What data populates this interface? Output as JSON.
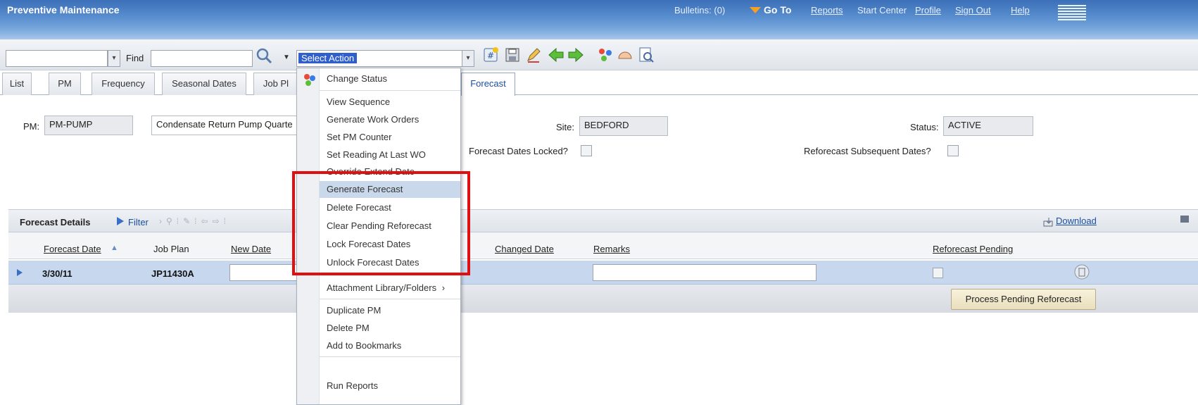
{
  "header": {
    "app_title": "Preventive Maintenance",
    "bulletins": "Bulletins: (0)",
    "go_to": "Go To",
    "links": [
      "Reports",
      "Start Center",
      "Profile",
      "Sign Out",
      "Help"
    ]
  },
  "toolbar": {
    "find_label": "Find",
    "select_action": "Select Action"
  },
  "tabs": [
    "List",
    "PM",
    "Frequency",
    "Seasonal Dates",
    "Job Pl",
    "Forecast"
  ],
  "fields": {
    "pm_label": "PM:",
    "pm_value": "PM-PUMP",
    "description": "Condensate Return Pump Quarte",
    "site_label": "Site:",
    "site_value": "BEDFORD",
    "status_label": "Status:",
    "status_value": "ACTIVE",
    "forecast_locked_label": "Forecast Dates Locked?",
    "reforecast_subsequent_label": "Reforecast Subsequent Dates?"
  },
  "forecast_details": {
    "title": "Forecast Details",
    "filter": "Filter",
    "download": "Download",
    "columns": [
      "Forecast Date",
      "Job Plan",
      "New Date",
      "Changed Date",
      "Remarks",
      "Reforecast Pending"
    ],
    "row": {
      "forecast_date": "3/30/11",
      "job_plan": "JP11430A"
    },
    "process_button": "Process Pending Reforecast"
  },
  "menu": {
    "items": [
      "Change Status",
      "View Sequence",
      "Generate Work Orders",
      "Set PM Counter",
      "Set Reading At Last WO",
      "Override Extend Date",
      "Generate Forecast",
      "Delete Forecast",
      "Clear Pending Reforecast",
      "Lock Forecast Dates",
      "Unlock Forecast Dates",
      "Attachment Library/Folders",
      "Duplicate PM",
      "Delete PM",
      "Add to Bookmarks",
      "Run Reports"
    ],
    "submenu_marker": "›"
  }
}
